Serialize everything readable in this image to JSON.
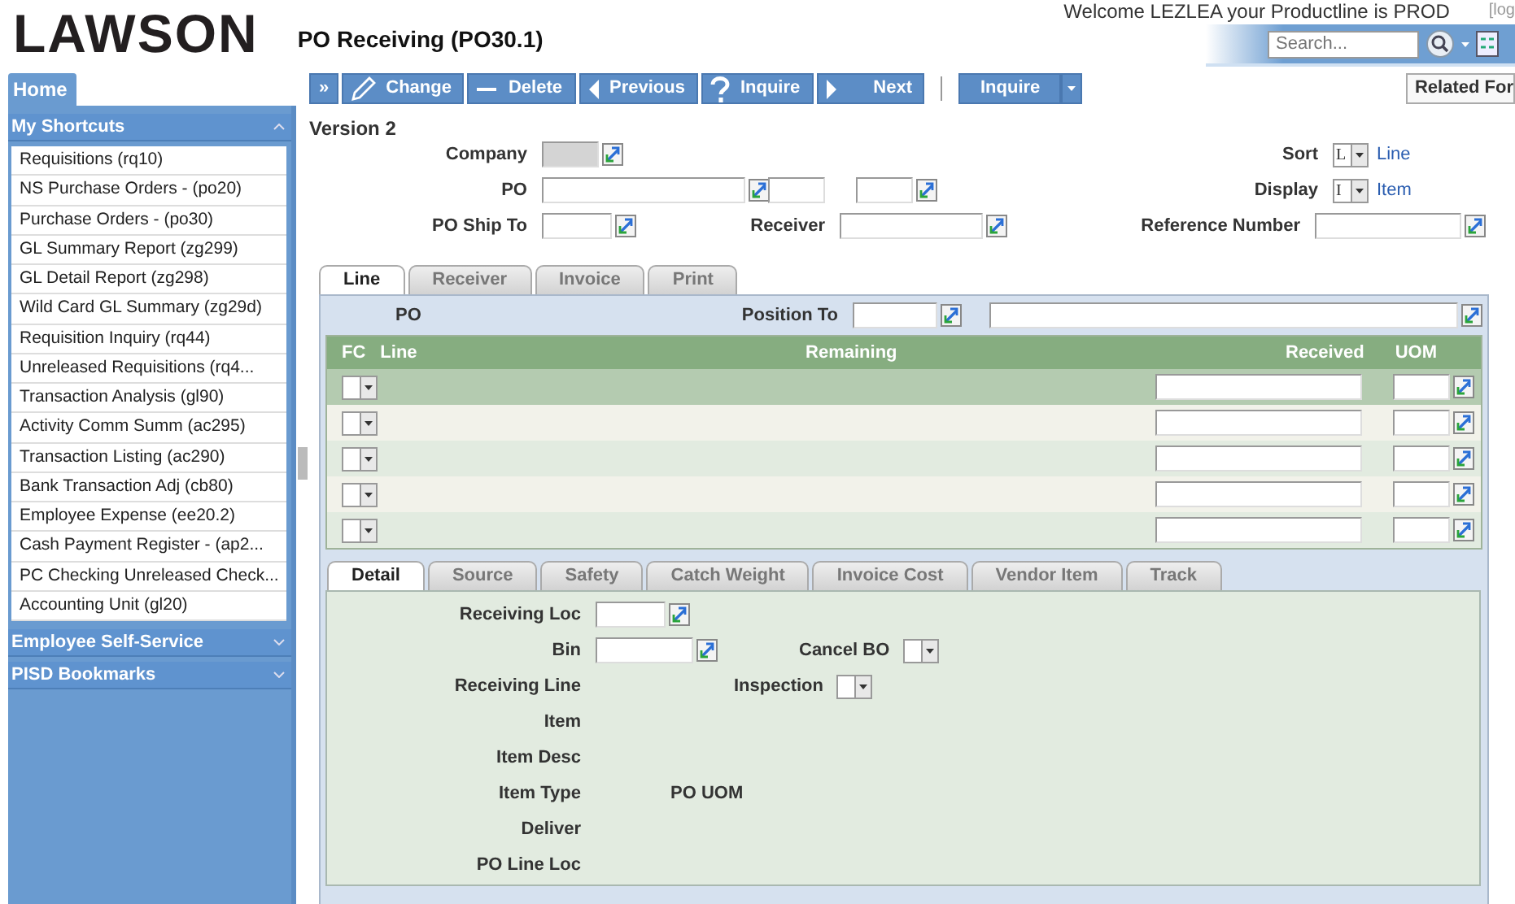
{
  "header": {
    "logo": "LAWSON",
    "form_title": "PO Receiving (PO30.1)",
    "welcome": "Welcome LEZLEA your Productline is PROD",
    "logout_link": "[log",
    "search": {
      "placeholder": "Search..."
    }
  },
  "sidebar": {
    "home_tab": "Home",
    "sections": [
      {
        "title": "My Shortcuts",
        "expanded": true,
        "items": [
          "Requisitions (rq10)",
          "NS Purchase Orders - (po20)",
          "Purchase Orders - (po30)",
          "GL Summary Report (zg299)",
          "GL Detail Report (zg298)",
          "Wild Card GL Summary (zg29d)",
          "Requisition Inquiry (rq44)",
          "Unreleased Requisitions (rq4...",
          "Transaction Analysis (gl90)",
          "Activity Comm Summ (ac295)",
          "Transaction Listing (ac290)",
          "Bank Transaction Adj (cb80)",
          "Employee Expense (ee20.2)",
          "Cash Payment Register - (ap2...",
          "PC Checking Unreleased Check...",
          "Accounting Unit (gl20)"
        ]
      },
      {
        "title": "Employee Self-Service",
        "expanded": false
      },
      {
        "title": "PISD Bookmarks",
        "expanded": false
      }
    ]
  },
  "toolbar": {
    "buttons": [
      {
        "kind": "expand",
        "label": "»"
      },
      {
        "kind": "edit",
        "label": "Change"
      },
      {
        "kind": "delete",
        "label": "Delete"
      },
      {
        "kind": "previous",
        "label": "Previous"
      },
      {
        "kind": "inquire",
        "label": "Inquire"
      },
      {
        "kind": "next",
        "label": "Next"
      }
    ],
    "split_button": "Inquire",
    "related_forms": "Related For"
  },
  "form": {
    "version": "Version 2",
    "company": {
      "label": "Company",
      "disabled": true
    },
    "po": {
      "label": "PO"
    },
    "po_ship_to": {
      "label": "PO Ship To"
    },
    "receiver": {
      "label": "Receiver"
    },
    "sort": {
      "label": "Sort",
      "value": "L",
      "description": "Line"
    },
    "display": {
      "label": "Display",
      "value": "I",
      "description": "Item"
    },
    "reference_number": {
      "label": "Reference Number"
    }
  },
  "line_tabs": [
    {
      "label": "Line",
      "selected": true
    },
    {
      "label": "Receiver",
      "selected": false
    },
    {
      "label": "Invoice",
      "selected": false
    },
    {
      "label": "Print",
      "selected": false
    }
  ],
  "line_panel": {
    "po_label": "PO",
    "position_to": "Position To",
    "columns": [
      "FC",
      "Line",
      "Remaining",
      "Received",
      "UOM"
    ],
    "rows": [
      {
        "selected": true
      },
      {
        "selected": false
      },
      {
        "selected": false
      },
      {
        "selected": false
      },
      {
        "selected": false
      }
    ]
  },
  "detail_tabs": [
    {
      "label": "Detail",
      "selected": true
    },
    {
      "label": "Source",
      "selected": false
    },
    {
      "label": "Safety",
      "selected": false
    },
    {
      "label": "Catch Weight",
      "selected": false
    },
    {
      "label": "Invoice Cost",
      "selected": false
    },
    {
      "label": "Vendor Item",
      "selected": false
    },
    {
      "label": "Track",
      "selected": false
    }
  ],
  "detail_rows": [
    {
      "label": "Receiving Loc",
      "kind": "lookup"
    },
    {
      "label": "Bin",
      "kind": "lookup_wide",
      "extra": {
        "label": "Cancel BO",
        "kind": "select"
      }
    },
    {
      "label": "Receiving Line",
      "kind": "text",
      "extra": {
        "label": "Inspection",
        "kind": "select"
      }
    },
    {
      "label": "Item",
      "kind": "text"
    },
    {
      "label": "Item Desc",
      "kind": "text"
    },
    {
      "label": "Item Type",
      "kind": "text",
      "extra": {
        "label": "PO UOM",
        "kind": "text"
      }
    },
    {
      "label": "Deliver",
      "kind": "text"
    },
    {
      "label": "PO Line Loc",
      "kind": "text"
    }
  ]
}
